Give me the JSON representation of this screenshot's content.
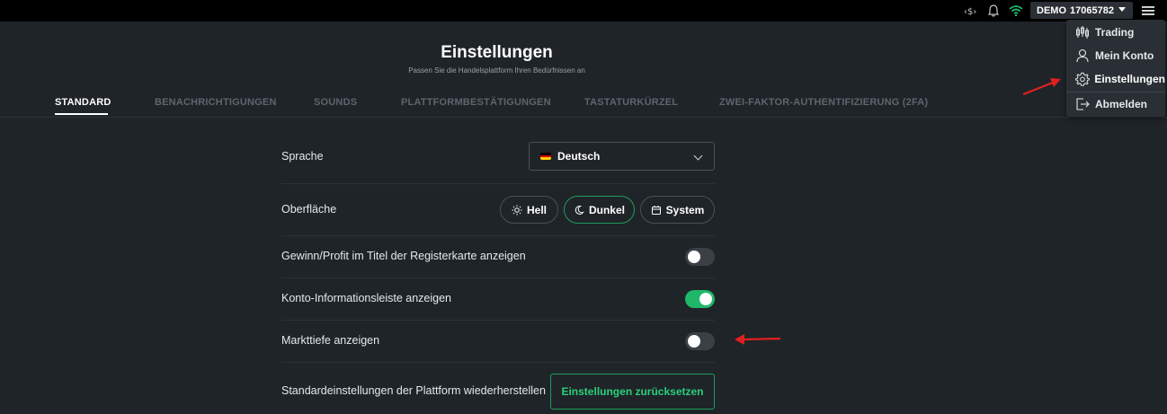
{
  "topbar": {
    "account_mode": "DEMO",
    "account_number": "17065782",
    "icons": [
      "currency-exchange-icon",
      "bell-icon",
      "wifi-icon",
      "hamburger-menu-icon"
    ]
  },
  "header": {
    "title": "Einstellungen",
    "subtitle": "Passen Sie die Handelsplattform Ihren Bedürfnissen an"
  },
  "tabs": [
    {
      "label": "STANDARD",
      "active": true
    },
    {
      "label": "BENACHRICHTIGUNGEN",
      "active": false
    },
    {
      "label": "SOUNDS",
      "active": false
    },
    {
      "label": "PLATTFORMBESTÄTIGUNGEN",
      "active": false
    },
    {
      "label": "TASTATURKÜRZEL",
      "active": false
    },
    {
      "label": "ZWEI-FAKTOR-AUTHENTIFIZIERUNG (2FA)",
      "active": false
    }
  ],
  "settings": {
    "language": {
      "label": "Sprache",
      "value": "Deutsch"
    },
    "theme": {
      "label": "Oberfläche",
      "options": [
        "Hell",
        "Dunkel",
        "System"
      ],
      "selected": "Dunkel"
    },
    "profit_in_tab": {
      "label": "Gewinn/Profit im Titel der Registerkarte anzeigen",
      "enabled": false
    },
    "account_info_bar": {
      "label": "Konto-Informationsleiste anzeigen",
      "enabled": true
    },
    "market_depth": {
      "label": "Markttiefe anzeigen",
      "enabled": false
    },
    "reset": {
      "label": "Standardeinstellungen der Plattform wiederherstellen",
      "button": "Einstellungen zurücksetzen"
    }
  },
  "menu": {
    "items": [
      {
        "label": "Trading",
        "icon": "candlestick-icon"
      },
      {
        "label": "Mein Konto",
        "icon": "user-icon"
      },
      {
        "label": "Einstellungen",
        "icon": "gear-icon",
        "active": true
      },
      {
        "label": "Abmelden",
        "icon": "logout-icon"
      }
    ]
  },
  "colors": {
    "background": "#1f2429",
    "accent_green": "#1fb86a",
    "annotation_arrow": "#e02020"
  }
}
